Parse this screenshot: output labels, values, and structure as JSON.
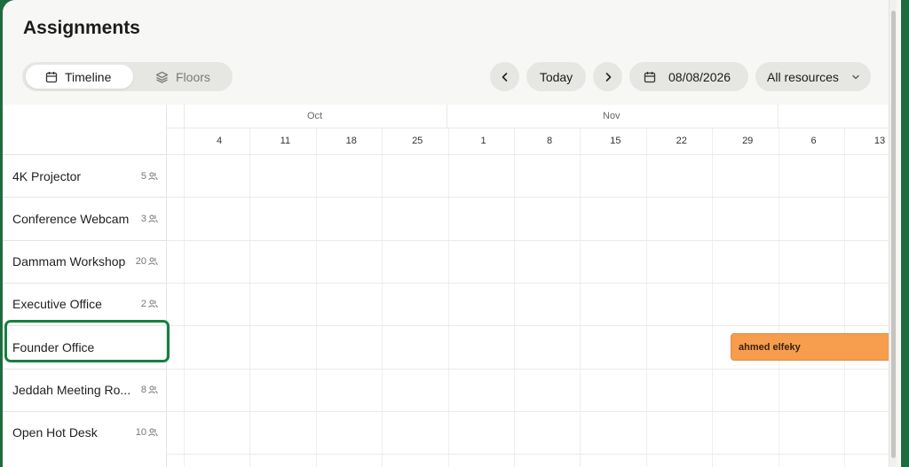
{
  "page": {
    "title": "Assignments"
  },
  "view_toggle": {
    "timeline_label": "Timeline",
    "floors_label": "Floors"
  },
  "toolbar": {
    "today_label": "Today",
    "date_value": "08/08/2026",
    "resource_filter": "All resources"
  },
  "timeline": {
    "months": [
      "Oct",
      "Nov"
    ],
    "weeks": [
      "4",
      "11",
      "18",
      "25",
      "1",
      "8",
      "15",
      "22",
      "29",
      "6",
      "13"
    ]
  },
  "resources": [
    {
      "name": "4K Projector",
      "capacity": "5"
    },
    {
      "name": "Conference Webcam",
      "capacity": "3"
    },
    {
      "name": "Dammam Workshop",
      "capacity": "20"
    },
    {
      "name": "Executive Office",
      "capacity": "2"
    },
    {
      "name": "Founder Office",
      "capacity": ""
    },
    {
      "name": "Jeddah Meeting Ro...",
      "capacity": "8"
    },
    {
      "name": "Open Hot Desk",
      "capacity": "10"
    }
  ],
  "bookings": [
    {
      "resource": "Founder Office",
      "label": "ahmed elfeky",
      "color": "#f79d4e"
    }
  ],
  "colors": {
    "accent_highlight": "#17803f",
    "booking": "#f79d4e"
  }
}
